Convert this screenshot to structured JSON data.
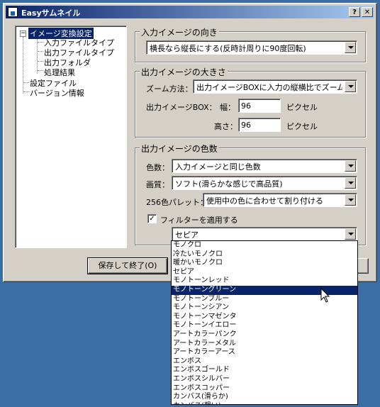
{
  "window": {
    "title": "Easyサムネイル",
    "help_glyph": "?",
    "close_glyph": "✕"
  },
  "tree": {
    "expander": "−",
    "items": [
      {
        "label": "イメージ変換設定"
      },
      {
        "label": "入力ファイルタイプ"
      },
      {
        "label": "出力ファイルタイプ"
      },
      {
        "label": "出力フォルダ"
      },
      {
        "label": "処理結果"
      },
      {
        "label": "設定ファイル"
      },
      {
        "label": "バージョン情報"
      }
    ]
  },
  "orientation": {
    "title": "入力イメージの向き",
    "value": "横長なら縦長にする(反時計周りに90度回転)"
  },
  "size": {
    "title": "出力イメージの大きさ",
    "zoom_label": "ズーム方法：",
    "zoom_value": "出力イメージBOXに入力の縦横比でズーム",
    "box_label": "出力イメージBOX：",
    "width_label": "幅：",
    "width_value": "96",
    "height_label": "高さ：",
    "height_value": "96",
    "unit": "ピクセル"
  },
  "colors": {
    "title": "出力イメージの色数",
    "count_label": "色数：",
    "count_value": "入力イメージと同じ色数",
    "quality_label": "画質：",
    "quality_value": "ソフト(滑らかな感じで高品質)",
    "palette_label": "256色パレット：",
    "palette_value": "使用中の色に合わせて割り付ける",
    "filter_checked": true,
    "filter_check_glyph": "✓",
    "filter_label": "フィルターを適用する",
    "filter_value": "セピア"
  },
  "buttons": {
    "save": "保存して終了(O)"
  },
  "filter_dropdown": {
    "highlighted_index": 5,
    "options": [
      "モノクロ",
      "冷たいモノクロ",
      "暖かいモノクロ",
      "セピア",
      "モノトーンレッド",
      "モノトーングリーン",
      "モノトーンブルー",
      "モノトーンシアン",
      "モノトーンマゼンタ",
      "モノトーンイエロー",
      "アートカラーパンク",
      "アートカラーメタル",
      "アートカラーアース",
      "エンボス",
      "エンボスゴールド",
      "エンボスシルバー",
      "エンボスコッパー",
      "カンバス(滑らか)",
      "カンバス(粗い)"
    ]
  }
}
